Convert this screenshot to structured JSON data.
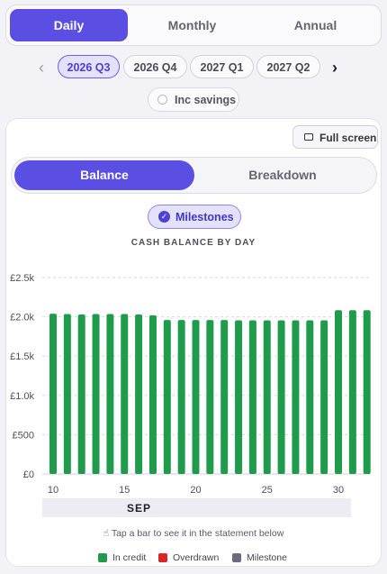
{
  "period_tabs": [
    {
      "label": "Daily",
      "active": true
    },
    {
      "label": "Monthly",
      "active": false
    },
    {
      "label": "Annual",
      "active": false
    }
  ],
  "quarters": [
    {
      "label": "2026 Q3",
      "active": true
    },
    {
      "label": "2026 Q4",
      "active": false
    },
    {
      "label": "2027 Q1",
      "active": false
    },
    {
      "label": "2027 Q2",
      "active": false
    }
  ],
  "nav": {
    "prev_icon": "chevron-left-icon",
    "next_icon": "chevron-right-icon"
  },
  "inc_savings": {
    "label": "Inc savings",
    "checked": false
  },
  "fullscreen": {
    "label": "Full screen",
    "icon": "fullscreen-icon"
  },
  "view_tabs": [
    {
      "label": "Balance",
      "active": true
    },
    {
      "label": "Breakdown",
      "active": false
    }
  ],
  "milestones_chip": {
    "label": "Milestones",
    "checked": true
  },
  "chart_hint": "Tap a bar to see it in the statement below",
  "month_label": "SEP",
  "legend": [
    {
      "label": "In credit",
      "color": "#1e9c4b"
    },
    {
      "label": "Overdrawn",
      "color": "#d62828"
    },
    {
      "label": "Milestone",
      "color": "#6b6b7a"
    }
  ],
  "colors": {
    "accent": "#5a4ee3",
    "in_credit": "#1e9c4b",
    "overdrawn": "#d62828",
    "milestone": "#6b6b7a"
  },
  "chart_data": {
    "type": "bar",
    "title": "CASH BALANCE BY DAY",
    "xlabel": "SEP",
    "ylabel": "",
    "ylim": [
      0,
      2500
    ],
    "yticks": [
      0,
      500,
      1000,
      1500,
      2000,
      2500
    ],
    "ytick_labels": [
      "£0",
      "£500",
      "£1.0k",
      "£1.5k",
      "£2.0k",
      "£2.5k"
    ],
    "xtick_labels": [
      "10",
      "15",
      "20",
      "25",
      "30"
    ],
    "categories": [
      10,
      11,
      12,
      13,
      14,
      15,
      16,
      17,
      18,
      19,
      20,
      21,
      22,
      23,
      24,
      25,
      26,
      27,
      28,
      29,
      30,
      31
    ],
    "values": [
      2040,
      2035,
      2030,
      2035,
      2035,
      2035,
      2030,
      2020,
      1960,
      1960,
      1960,
      1960,
      1960,
      1955,
      1955,
      1955,
      1955,
      1955,
      1955,
      1955,
      2085,
      2085,
      2085
    ],
    "grid": true
  }
}
